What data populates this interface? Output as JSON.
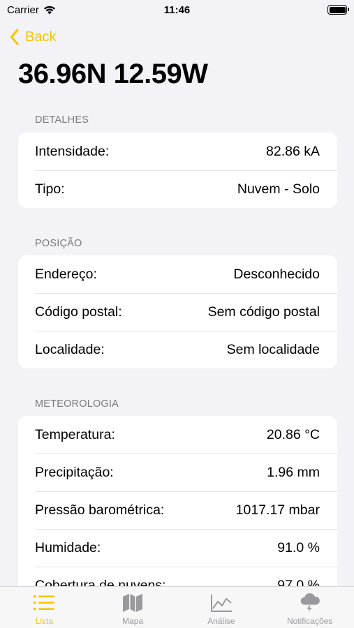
{
  "status_bar": {
    "carrier": "Carrier",
    "time": "11:46"
  },
  "nav": {
    "back_label": "Back"
  },
  "title": "36.96N 12.59W",
  "accent_color": "#f7c500",
  "sections": [
    {
      "header": "DETALHES",
      "rows": [
        {
          "label": "Intensidade:",
          "value": "82.86 kA"
        },
        {
          "label": "Tipo:",
          "value": "Nuvem - Solo"
        }
      ]
    },
    {
      "header": "POSIÇÃO",
      "rows": [
        {
          "label": "Endereço:",
          "value": "Desconhecido"
        },
        {
          "label": "Código postal:",
          "value": "Sem código postal"
        },
        {
          "label": "Localidade:",
          "value": "Sem localidade"
        }
      ]
    },
    {
      "header": "METEOROLOGIA",
      "rows": [
        {
          "label": "Temperatura:",
          "value": "20.86 °C"
        },
        {
          "label": "Precipitação:",
          "value": "1.96 mm"
        },
        {
          "label": "Pressão barométrica:",
          "value": "1017.17 mbar"
        },
        {
          "label": "Humidade:",
          "value": "91.0 %"
        },
        {
          "label": "Cobertura de nuvens:",
          "value": "97.0 %"
        }
      ]
    }
  ],
  "tabs": [
    {
      "label": "Lista",
      "icon": "list-icon",
      "active": true
    },
    {
      "label": "Mapa",
      "icon": "map-icon",
      "active": false
    },
    {
      "label": "Análise",
      "icon": "chart-icon",
      "active": false
    },
    {
      "label": "Notificações",
      "icon": "storm-cloud-icon",
      "active": false
    }
  ]
}
